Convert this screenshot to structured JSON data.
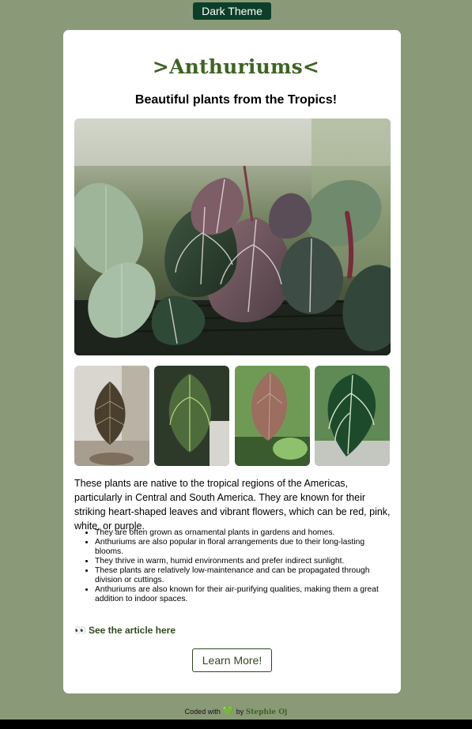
{
  "theme_toggle": {
    "label": "Dark Theme"
  },
  "card": {
    "title": ">Anthuriums<",
    "subtitle": "Beautiful plants from the Tropics!",
    "intro": "These plants are native to the tropical regions of the Americas, particularly in Central and South America. They are known for their striking heart-shaped leaves and vibrant flowers, which can be red, pink, white, or purple.",
    "facts": [
      "They are often grown as ornamental plants in gardens and homes.",
      "Anthuriums are also popular in floral arrangements due to their long-lasting blooms.",
      "They thrive in warm, humid environments and prefer indirect sunlight.",
      "These plants are relatively low-maintenance and can be propagated through division or cuttings.",
      "Anthuriums are also known for their air-purifying qualities, making them a great addition to indoor spaces."
    ],
    "article_icon": "👀",
    "article_link": "See the article here",
    "learn_more": "Learn More!"
  },
  "footer": {
    "prefix": "Coded with",
    "heart": "💚",
    "by": "by",
    "author": "Stephie Oj"
  },
  "colors": {
    "page_background": "#8a9a78",
    "accent_dark_green": "#0c3f2a",
    "title_green": "#3e6423",
    "heart_green": "#22c52b"
  }
}
